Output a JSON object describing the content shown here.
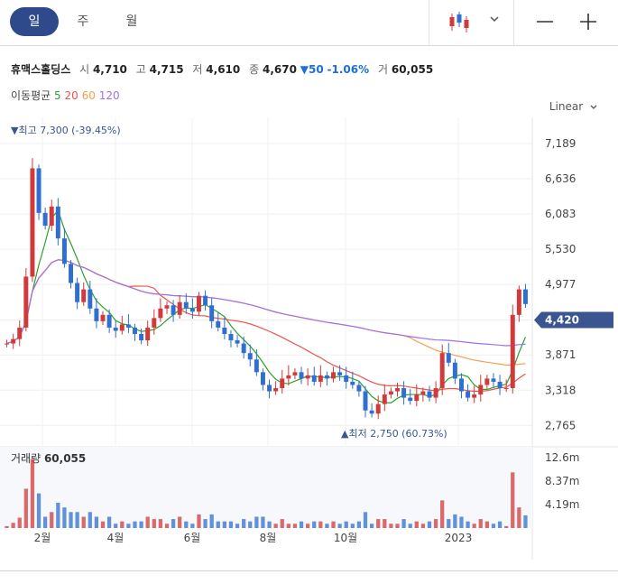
{
  "tabs": [
    {
      "label": "일",
      "active": true
    },
    {
      "label": "주",
      "active": false
    },
    {
      "label": "월",
      "active": false
    }
  ],
  "toolbar": {
    "chart_type_icon": "candlestick-icon",
    "dropdown_icon": "chevron-down-icon",
    "zoom_out_icon": "minus-icon",
    "zoom_in_icon": "plus-icon"
  },
  "stock": {
    "name": "휴맥스홀딩스",
    "open_label": "시",
    "open": "4,710",
    "high_label": "고",
    "high": "4,715",
    "low_label": "저",
    "low": "4,610",
    "close_label": "종",
    "close": "4,670",
    "change": "▼50",
    "change_pct": "-1.06%",
    "volume_label": "거",
    "volume": "60,055"
  },
  "moving_average": {
    "label": "이동평균",
    "periods": [
      {
        "label": "5",
        "color": "#2ca02c"
      },
      {
        "label": "20",
        "color": "#e8544e"
      },
      {
        "label": "60",
        "color": "#f0a050"
      },
      {
        "label": "120",
        "color": "#a070e8"
      }
    ]
  },
  "scale_select": {
    "label": "Linear",
    "icon": "chevron-down-icon"
  },
  "colors": {
    "up": "#d03a3a",
    "down": "#2f6fd0",
    "accent": "#2f4a8a",
    "price_tag": "#3a5590"
  },
  "chart_data": {
    "type": "candlestick",
    "price_axis": {
      "ticks": [
        "7,189",
        "6,636",
        "6,083",
        "5,530",
        "4,977",
        "4,420",
        "3,871",
        "3,318",
        "2,765"
      ],
      "range": [
        2500,
        7600
      ]
    },
    "x_ticks": [
      "2월",
      "4월",
      "6월",
      "8월",
      "10월",
      "2023"
    ],
    "current_price_label": "4,420",
    "high_annotation": "▼최고 7,300 (-39.45%)",
    "low_annotation": "▲최저 2,750 (60.73%)",
    "close_series": [
      4050,
      4120,
      4300,
      5100,
      6800,
      6100,
      5900,
      6200,
      5700,
      5300,
      5000,
      4700,
      4900,
      4600,
      4400,
      4500,
      4300,
      4250,
      4350,
      4300,
      4200,
      4100,
      4300,
      4450,
      4600,
      4650,
      4500,
      4700,
      4600,
      4550,
      4800,
      4650,
      4400,
      4300,
      4200,
      4100,
      4050,
      3900,
      3800,
      3600,
      3400,
      3300,
      3350,
      3500,
      3550,
      3600,
      3500,
      3550,
      3450,
      3550,
      3500,
      3600,
      3550,
      3450,
      3400,
      3300,
      3000,
      2950,
      3100,
      3250,
      3300,
      3350,
      3200,
      3150,
      3250,
      3300,
      3200,
      3350,
      3900,
      3750,
      3500,
      3300,
      3200,
      3250,
      3400,
      3500,
      3450,
      3350,
      3350,
      4500,
      4900,
      4670
    ],
    "volume_axis": {
      "label": "거래량",
      "value": "60,055",
      "ticks": [
        "12.6m",
        "8.37m",
        "4.19m"
      ],
      "max": 14.5
    }
  }
}
